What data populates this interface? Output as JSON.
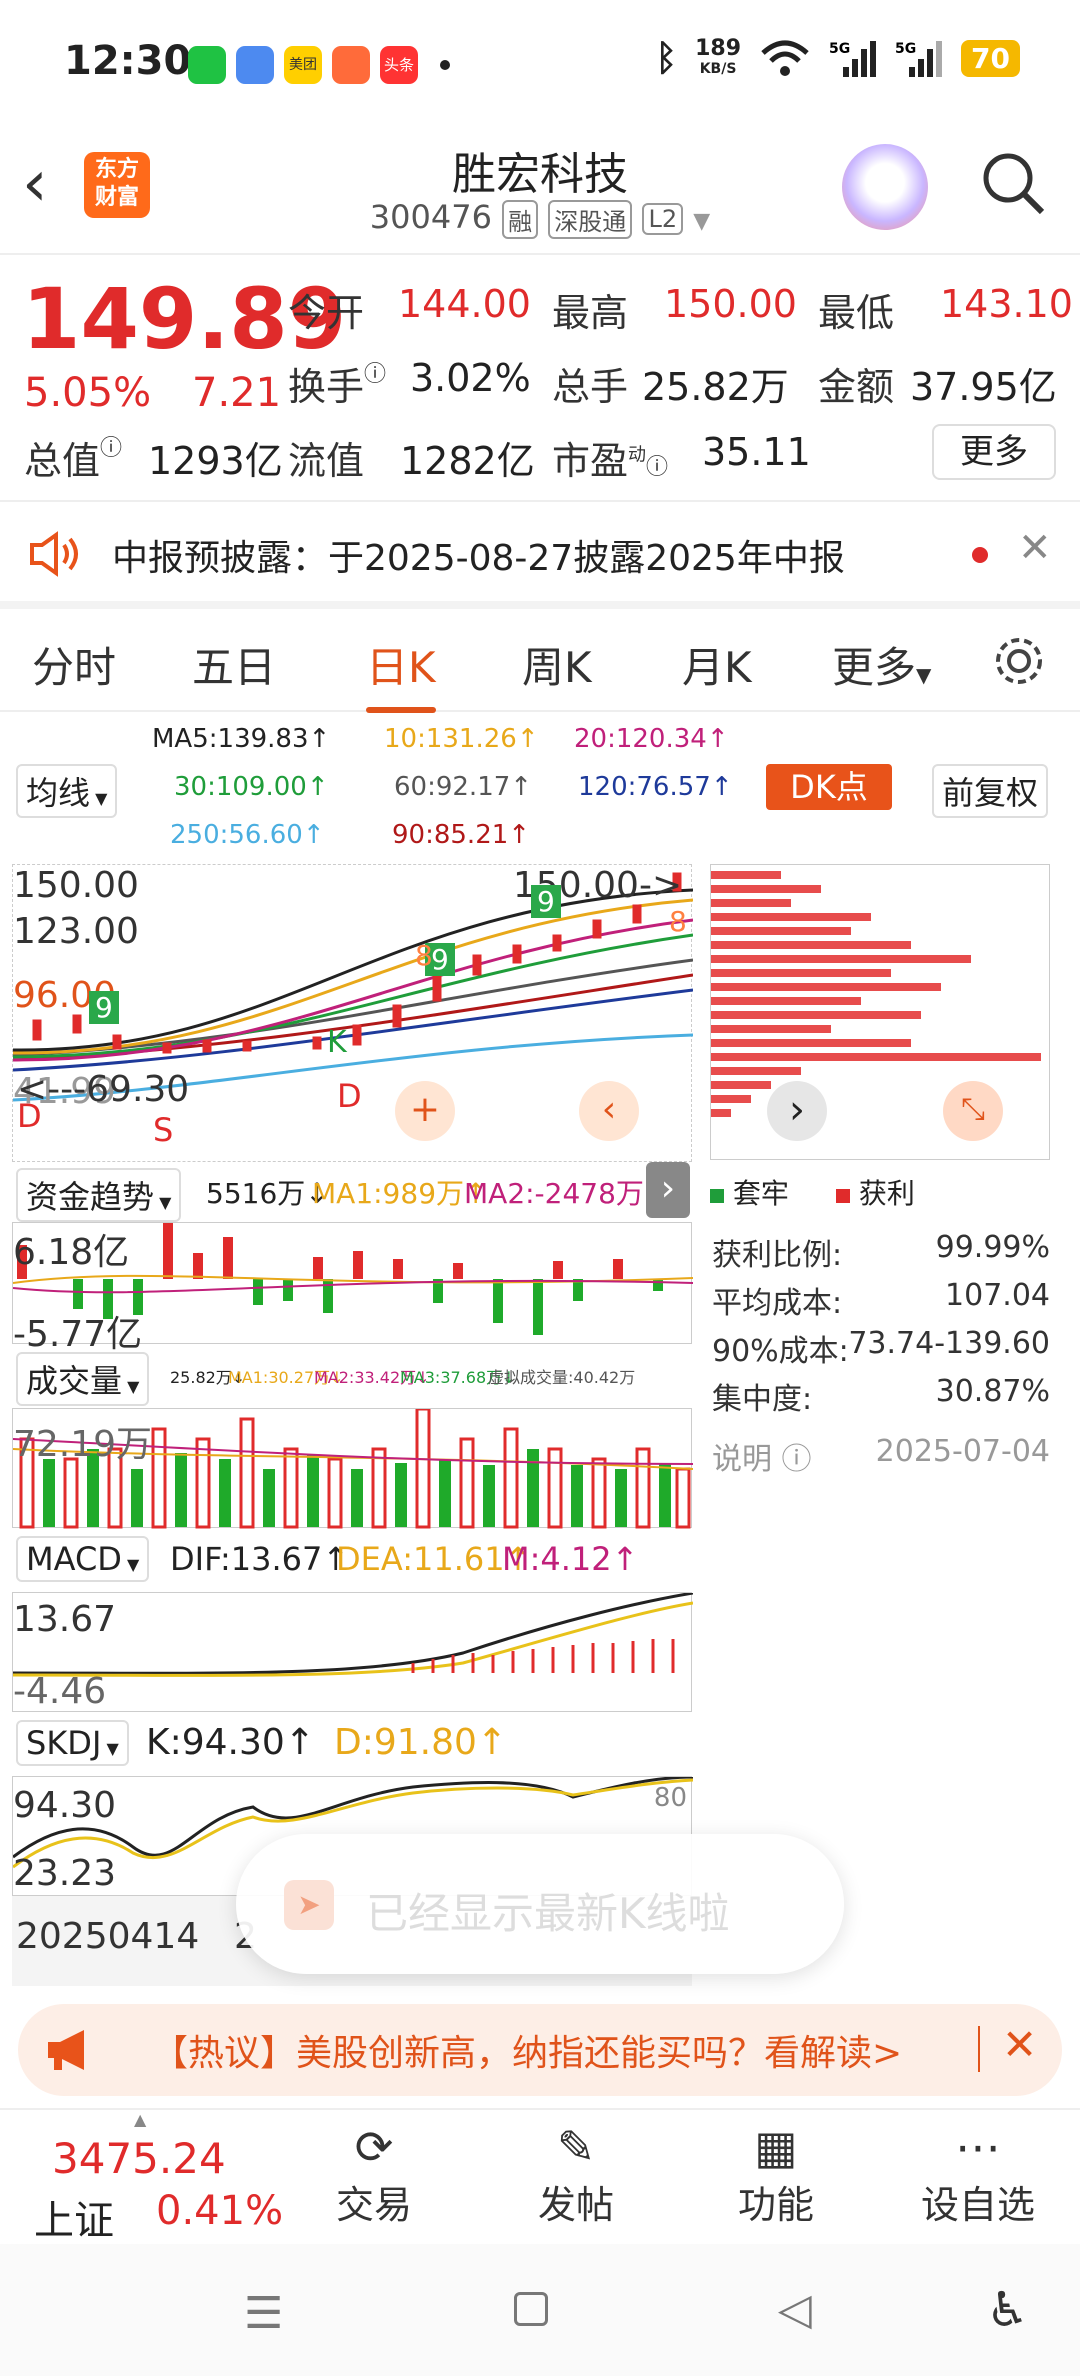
{
  "status": {
    "time": "12:30",
    "net_speed_top": "189",
    "net_speed_bottom": "KB/S",
    "battery": "70",
    "apps": [
      "wechat-icon",
      "cloud-icon",
      "meituan-icon",
      "video-icon",
      "toutiao-icon"
    ],
    "app_labels": {
      "meituan": "美团",
      "toutiao": "头条"
    }
  },
  "header": {
    "logo_line1": "东方",
    "logo_line2": "财富",
    "stock_name": "胜宏科技",
    "code": "300476",
    "tag_margin": "融",
    "tag_connect": "深股通",
    "tag_level": "L2"
  },
  "quote": {
    "price": "149.89",
    "pct": "5.05%",
    "change": "7.21",
    "open_label": "今开",
    "open": "144.00",
    "high_label": "最高",
    "high": "150.00",
    "low_label": "最低",
    "low": "143.10",
    "turnover_label": "换手",
    "turnover": "3.02%",
    "volume_label": "总手",
    "volume": "25.82万",
    "amount_label": "金额",
    "amount": "37.95亿",
    "mktcap_label": "总值",
    "mktcap": "1293亿",
    "float_label": "流值",
    "float": "1282亿",
    "pe_label": "市盈",
    "pe_sup": "动",
    "pe": "35.11",
    "more": "更多"
  },
  "notice": {
    "text": "中报预披露：于2025-08-27披露2025年中报"
  },
  "tabs": [
    "分时",
    "五日",
    "日K",
    "周K",
    "月K",
    "更多"
  ],
  "kline": {
    "selector": "均线",
    "ma5": "MA5:139.83↑",
    "ma10": "10:131.26↑",
    "ma20": "20:120.34↑",
    "ma30": "30:109.00↑",
    "ma60": "60:92.17↑",
    "ma120": "120:76.57↑",
    "ma250": "250:56.60↑",
    "ma90": "90:85.21↑",
    "dk": "DK点",
    "adjust": "前复权",
    "y_top": "150.00",
    "y_2": "123.00",
    "y_3": "96.00",
    "y_4": "69.30",
    "y_low": "41.99",
    "high_mark": "150.00->",
    "low_mark": "<---69.30",
    "label_d1": "D",
    "label_s": "S",
    "label_d2": "D",
    "label_k": "K",
    "label_9a": "9",
    "label_9b": "9",
    "label_9c": "9",
    "label_8a": "8",
    "label_8b": "8"
  },
  "chip": {
    "legend_trapped": "套牢",
    "legend_profit": "获利",
    "rows": [
      {
        "label": "获利比例:",
        "value": "99.99%"
      },
      {
        "label": "平均成本:",
        "value": "107.04"
      },
      {
        "label": "90%成本:",
        "value": "73.74-139.60"
      },
      {
        "label": "集中度:",
        "value": "30.87%"
      }
    ],
    "note": "说明",
    "date": "2025-07-04"
  },
  "fund": {
    "selector": "资金趋势",
    "v": "5516万↓",
    "ma1": "MA1:989万↑",
    "ma2": "MA2:-2478万↑",
    "y_top": "6.18亿",
    "y_bot": "-5.77亿"
  },
  "vol": {
    "selector": "成交量",
    "v": "25.82万↓",
    "ma1": "MA1:30.27万↓",
    "ma2": "MA2:33.42万↓",
    "ma3": "MA3:37.68万↓",
    "virtual": "虚拟成交量:40.42万",
    "y_top": "72.19万"
  },
  "macd": {
    "selector": "MACD",
    "dif": "DIF:13.67↑",
    "dea": "DEA:11.61↑",
    "m": "M:4.12↑",
    "y_top": "13.67",
    "y_bot": "-4.46"
  },
  "skdj": {
    "selector": "SKDJ",
    "k": "K:94.30↑",
    "d": "D:91.80↑",
    "y_top": "94.30",
    "y_bot": "23.23",
    "ref80": "80",
    "date_start": "20250414",
    "date_mid": "2"
  },
  "toast": {
    "text": "已经显示最新K线啦"
  },
  "hot": {
    "text": "【热议】美股创新高，纳指还能买吗？看解读>"
  },
  "bottom": {
    "index_value": "3475.24",
    "index_name": "上证",
    "index_pct": "0.41%",
    "items": [
      "交易",
      "发帖",
      "功能",
      "设自选"
    ]
  },
  "colors": {
    "up": "#e02b2b",
    "down": "#1f9d3a",
    "accent": "#e0531a"
  }
}
